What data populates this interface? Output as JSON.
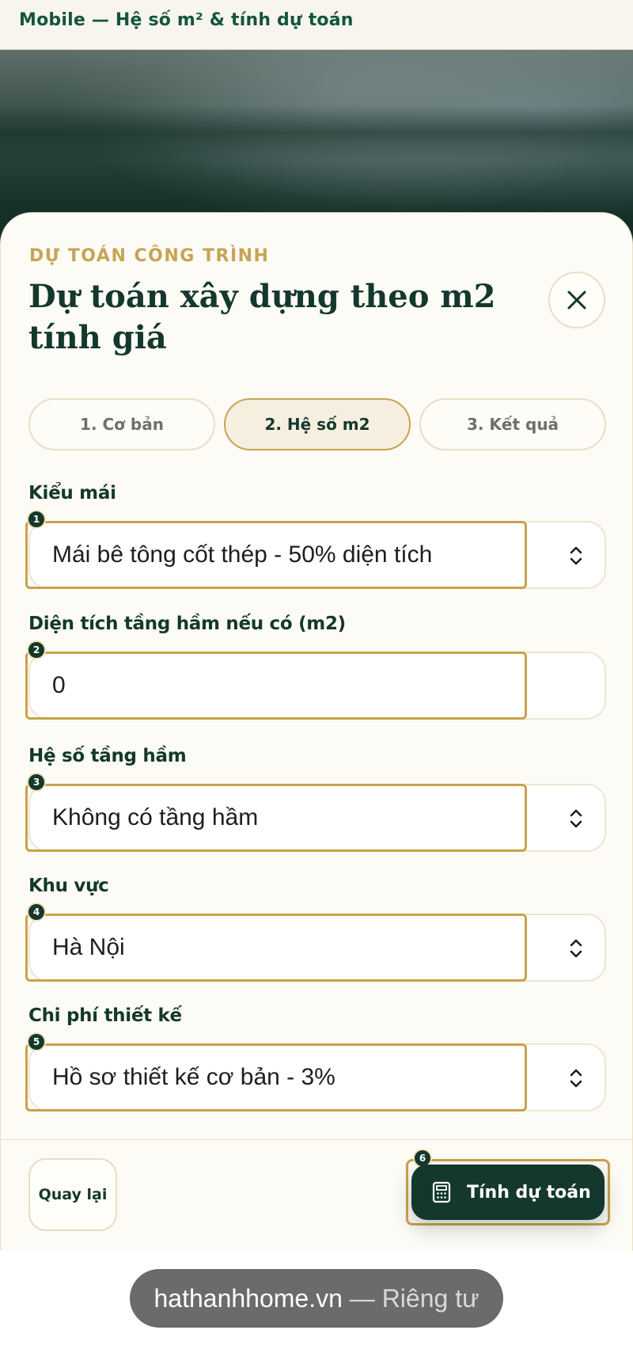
{
  "header": {
    "title": "Mobile — Hệ số m² & tính dự toán"
  },
  "sheet": {
    "eyebrow": "DỰ TOÁN CÔNG TRÌNH",
    "title": "Dự toán xây dựng theo m2 tính giá",
    "close_icon": "close-icon"
  },
  "tabs": [
    {
      "label": "1. Cơ bản",
      "active": false
    },
    {
      "label": "2. Hệ số m2",
      "active": true
    },
    {
      "label": "3. Kết quả",
      "active": false
    }
  ],
  "fields": [
    {
      "label": "Kiểu mái",
      "value": "Mái bê tông cốt thép - 50% diện tích",
      "type": "select",
      "badge": "1"
    },
    {
      "label": "Diện tích tầng hầm nếu có (m2)",
      "value": "0",
      "type": "input",
      "badge": "2"
    },
    {
      "label": "Hệ số tầng hầm",
      "value": "Không có tầng hầm",
      "type": "select",
      "badge": "3"
    },
    {
      "label": "Khu vực",
      "value": "Hà Nội",
      "type": "select",
      "badge": "4"
    },
    {
      "label": "Chi phí thiết kế",
      "value": "Hồ sơ thiết kế cơ bản - 3%",
      "type": "select",
      "badge": "5"
    }
  ],
  "footer": {
    "back_label": "Quay lại",
    "calc_label": "Tính dự toán",
    "calc_badge": "6",
    "calc_icon": "calculator-icon"
  },
  "browser": {
    "domain": "hathanhhome.vn",
    "separator": " — ",
    "mode": "Riêng tư"
  },
  "colors": {
    "primary": "#14382d",
    "accent": "#c8a356",
    "sheet_bg": "#fcfbf5"
  }
}
